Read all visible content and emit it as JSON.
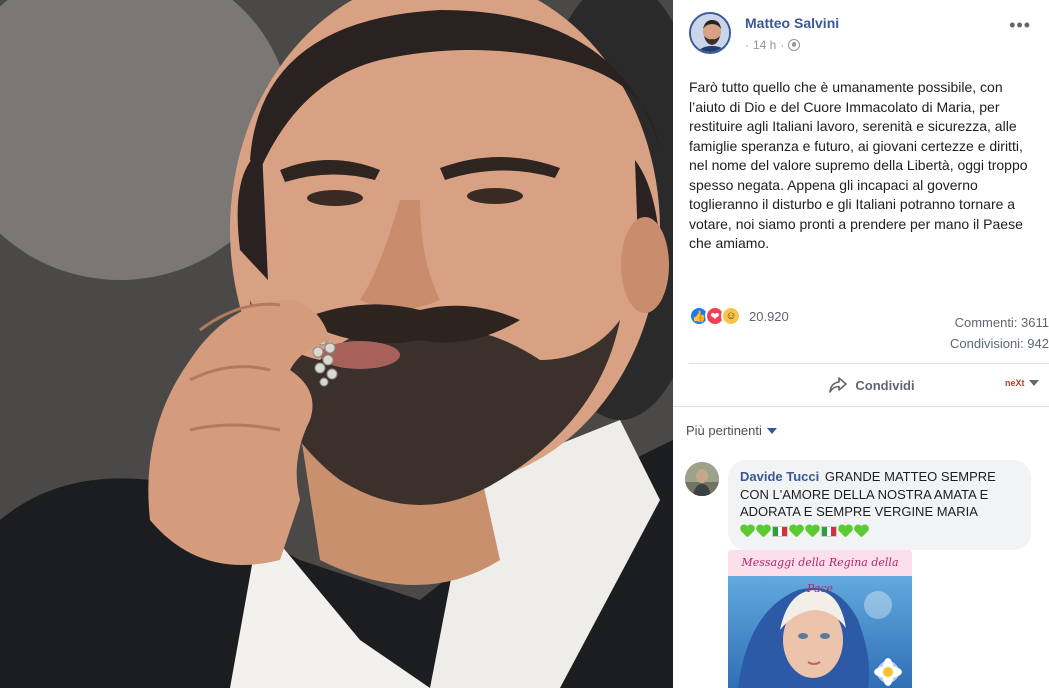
{
  "post": {
    "author": "Matteo Salvini",
    "time": "14 h",
    "separator": "·",
    "options_icon": "more-horizontal-icon",
    "privacy_icon": "globe-icon",
    "text": "Farò tutto quello che è umanamente possibile, con l’aiuto di Dio e del Cuore Immacolato di Maria, per restituire agli Italiani lavoro, serenità e sicurezza, alle famiglie speranza e futuro, ai giovani certezze e diritti, nel nome del valore supremo della Libertà, oggi troppo spesso negata. Appena gli incapaci al governo toglieranno il disturbo e gli Italiani potranno tornare a votare, noi siamo pronti a prendere per mano il Paese che amiamo."
  },
  "stats": {
    "reaction_icons": [
      "like-icon",
      "love-icon",
      "haha-icon"
    ],
    "reactions_count": "20.920",
    "comments": "Commenti: 3611",
    "shares": "Condivisioni: 942"
  },
  "actions": {
    "share_label": "Condividi",
    "share_icon": "share-arrow-icon",
    "page_logo": "neXt"
  },
  "sort": {
    "label": "Più pertinenti"
  },
  "comment": {
    "author": "Davide Tucci",
    "text": "GRANDE MATTEO SEMPRE CON L'AMORE DELLA NOSTRA AMATA E ADORATA E SEMPRE VERGINE MARIA",
    "emojis": [
      "green-heart",
      "green-heart",
      "italy-flag",
      "green-heart",
      "green-heart",
      "italy-flag",
      "green-heart",
      "green-heart"
    ],
    "image_caption": "Messaggi della Regina della Pace"
  },
  "colors": {
    "link_blue": "#385898",
    "meta_grey": "#90949c",
    "bubble_bg": "#f2f3f5"
  }
}
